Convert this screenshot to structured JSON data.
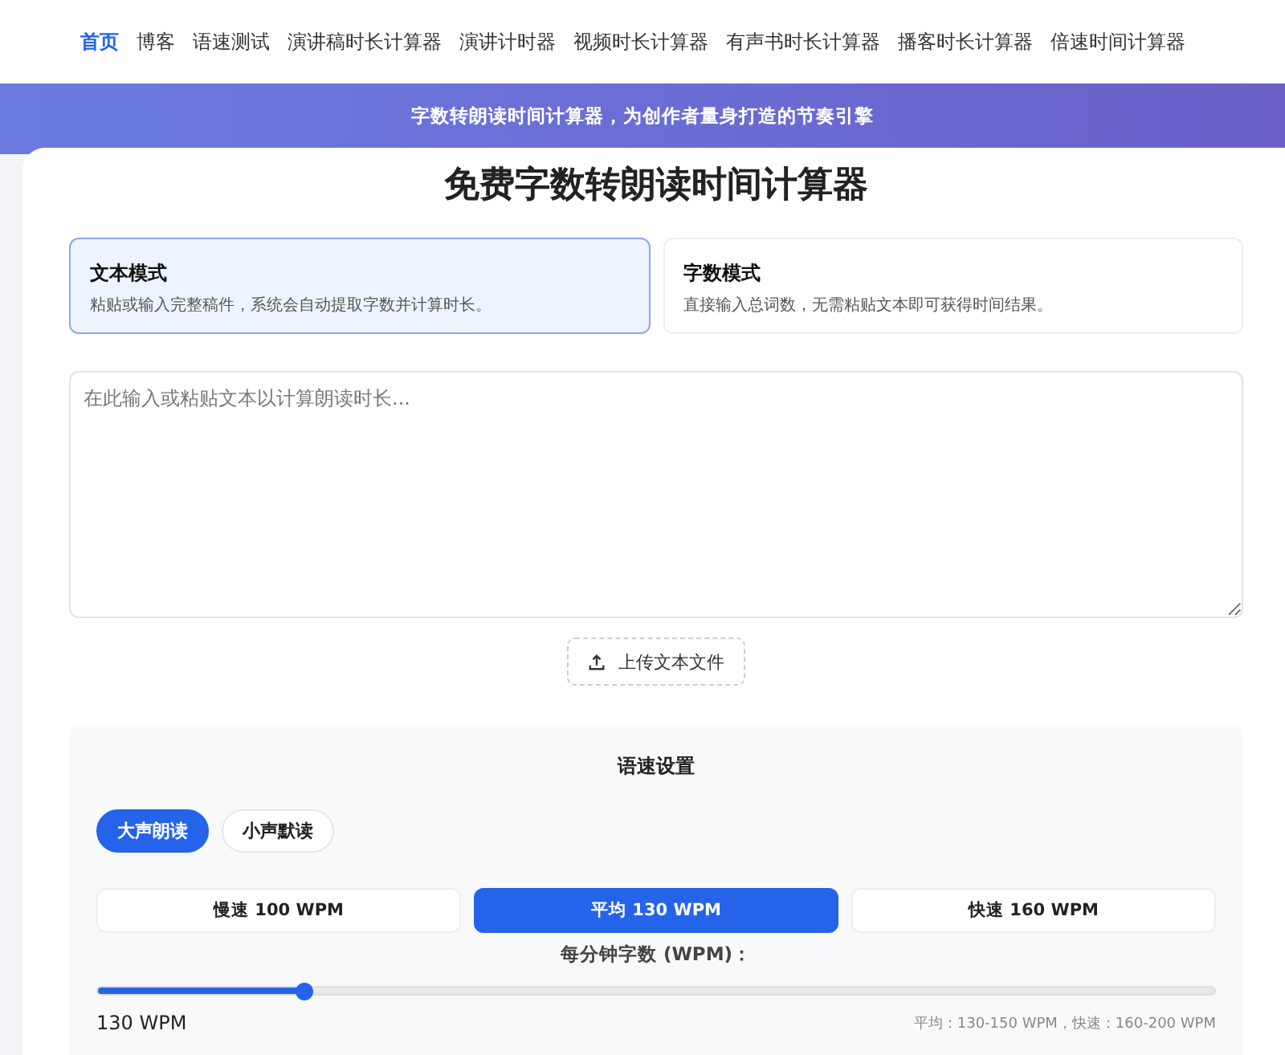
{
  "nav": {
    "items": [
      {
        "label": "首页",
        "selected": true
      },
      {
        "label": "博客",
        "selected": false
      },
      {
        "label": "语速测试",
        "selected": false
      },
      {
        "label": "演讲稿时长计算器",
        "selected": false
      },
      {
        "label": "演讲计时器",
        "selected": false
      },
      {
        "label": "视频时长计算器",
        "selected": false
      },
      {
        "label": "有声书时长计算器",
        "selected": false
      },
      {
        "label": "播客时长计算器",
        "selected": false
      },
      {
        "label": "倍速时间计算器",
        "selected": false
      }
    ]
  },
  "banner": {
    "text": "字数转朗读时间计算器，为创作者量身打造的节奏引擎"
  },
  "title": "免费字数转朗读时间计算器",
  "modes": [
    {
      "title": "文本模式",
      "description": "粘贴或输入完整稿件，系统会自动提取字数并计算时长。",
      "selected": true
    },
    {
      "title": "字数模式",
      "description": "直接输入总词数，无需粘贴文本即可获得时间结果。",
      "selected": false
    }
  ],
  "text_input": {
    "placeholder": "在此输入或粘贴文本以计算朗读时长..."
  },
  "upload_button": "上传文本文件",
  "speed_settings": {
    "title": "语速设置",
    "reading_types": [
      {
        "label": "大声朗读",
        "selected": true
      },
      {
        "label": "小声默读",
        "selected": false
      }
    ],
    "presets": [
      {
        "label": "慢速 100 WPM",
        "selected": false
      },
      {
        "label": "平均 130 WPM",
        "selected": true
      },
      {
        "label": "快速 160 WPM",
        "selected": false
      }
    ],
    "slider_label": "每分钟字数 (WPM)：",
    "slider": {
      "level": 0.185
    },
    "reading": "130 WPM",
    "hint": "平均：130-150 WPM，快速：160-200 WPM"
  }
}
